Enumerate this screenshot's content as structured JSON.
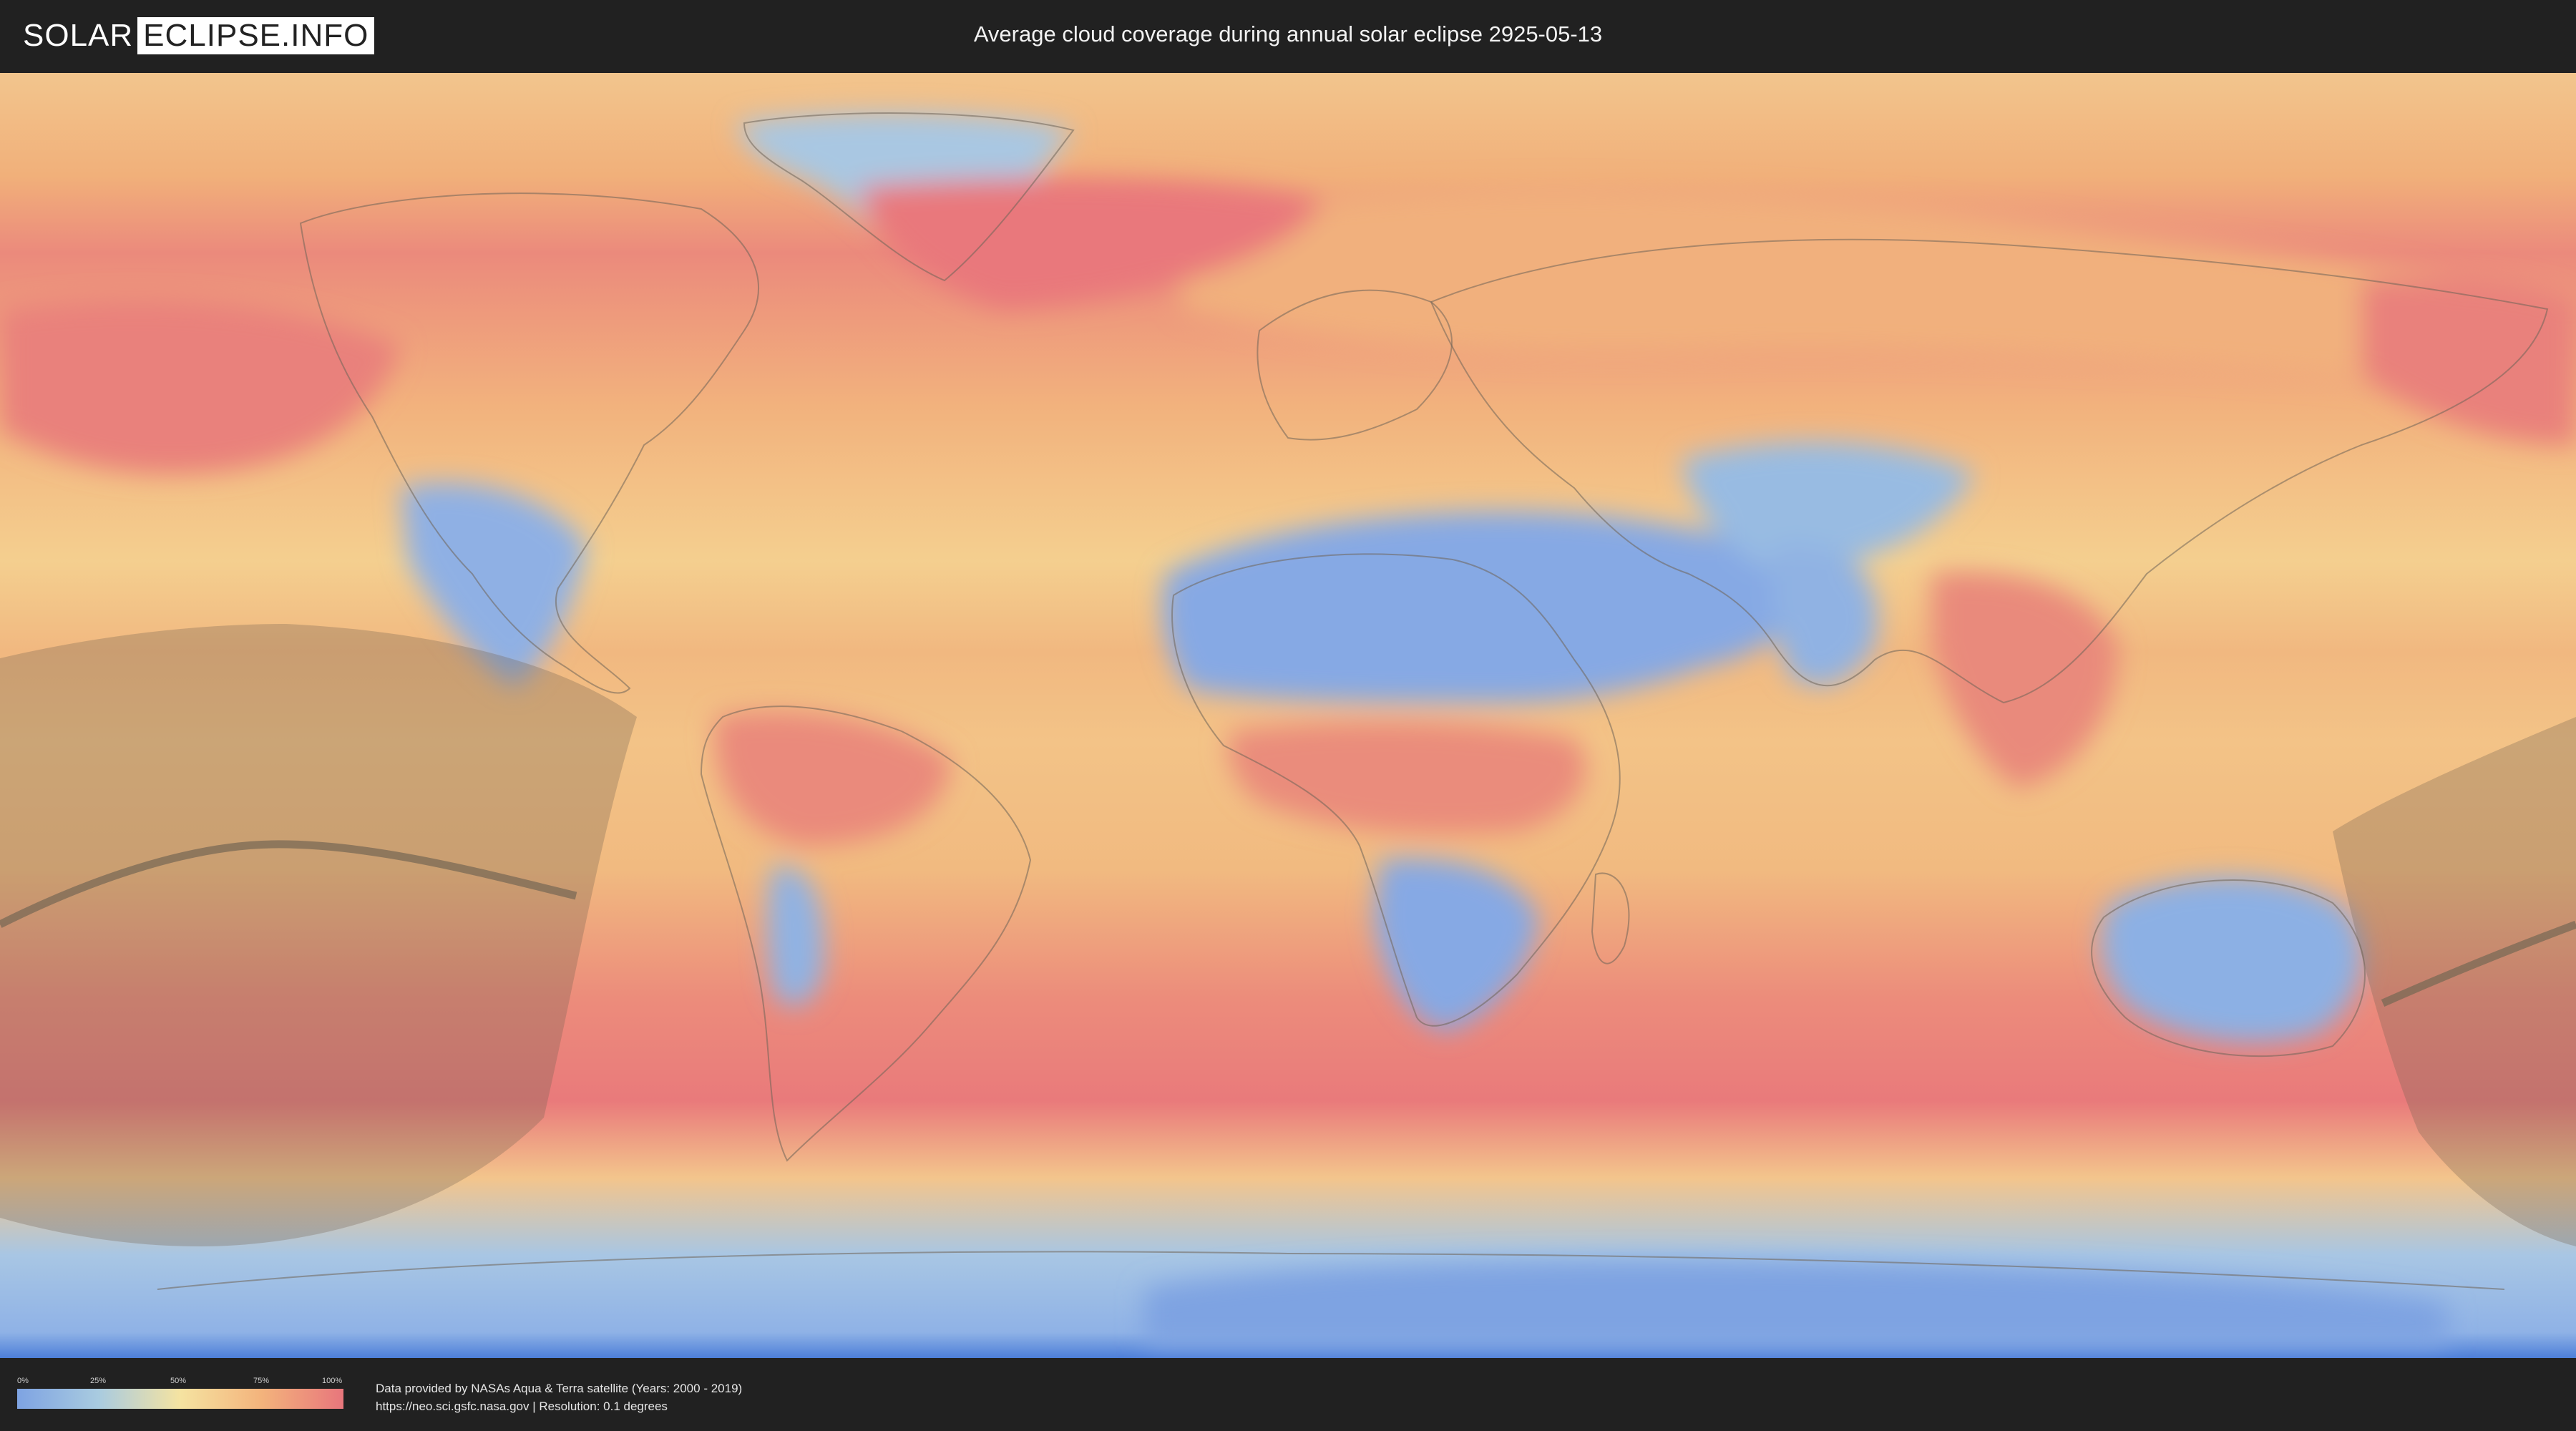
{
  "header": {
    "logo_left": "SOLAR",
    "logo_right": "ECLIPSE.INFO",
    "title": "Average cloud coverage during annual solar eclipse 2925-05-13"
  },
  "legend": {
    "ticks": [
      "0%",
      "25%",
      "50%",
      "75%",
      "100%"
    ],
    "colors": [
      "#7ea3e2",
      "#a9cbe0",
      "#f5e3a1",
      "#f3b37c",
      "#e8767c"
    ]
  },
  "footer": {
    "source_line1": "Data provided by NASAs Aqua & Terra satellite (Years: 2000 - 2019)",
    "source_line2": "https://neo.sci.gsfc.nasa.gov | Resolution: 0.1 degrees"
  },
  "colors": {
    "background": "#212121",
    "cloud_low": "#7ea3e2",
    "cloud_high": "#e8767c",
    "eclipse_shadow": "#7a6a55"
  }
}
